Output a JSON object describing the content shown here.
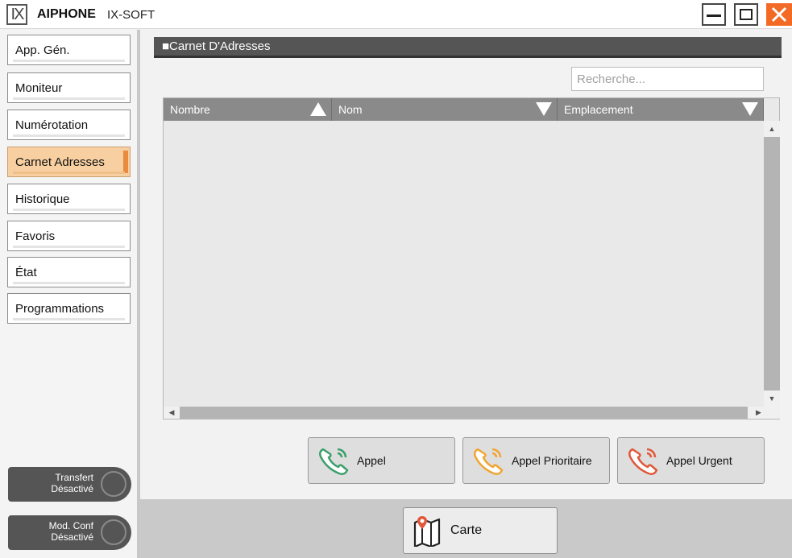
{
  "window": {
    "logo_text": "IX",
    "brand": "AIPHONE",
    "product": "IX-SOFT",
    "close_glyph": "✕"
  },
  "sidebar": {
    "items": [
      {
        "label": "App. Gén."
      },
      {
        "label": "Moniteur"
      },
      {
        "label": "Numérotation"
      },
      {
        "label": "Carnet Adresses",
        "active": true
      },
      {
        "label": "Historique"
      },
      {
        "label": "Favoris"
      },
      {
        "label": "État"
      },
      {
        "label": "Programmations"
      }
    ],
    "status": [
      {
        "line1": "Transfert",
        "line2": "Désactivé"
      },
      {
        "line1": "Mod. Conf",
        "line2": "Désactivé"
      }
    ]
  },
  "main": {
    "title": "■Carnet D'Adresses",
    "search_placeholder": "Recherche...",
    "table": {
      "columns": [
        {
          "label": "Nombre",
          "sort": "up"
        },
        {
          "label": "Nom",
          "sort": "down"
        },
        {
          "label": "Emplacement",
          "sort": "down"
        }
      ],
      "rows": []
    },
    "actions": [
      {
        "label": "Appel",
        "icon": "phone-green-icon",
        "color": "#3aa06a"
      },
      {
        "label": "Appel Prioritaire",
        "icon": "phone-yellow-icon",
        "color": "#f2a532"
      },
      {
        "label": "Appel Urgent",
        "icon": "phone-red-icon",
        "color": "#e2573a"
      }
    ],
    "map_button": {
      "label": "Carte",
      "icon": "map-icon"
    }
  },
  "colors": {
    "accent": "#e98a3d",
    "active_nav": "#f7cfa0",
    "header": "#555555",
    "close": "#f26a24"
  }
}
